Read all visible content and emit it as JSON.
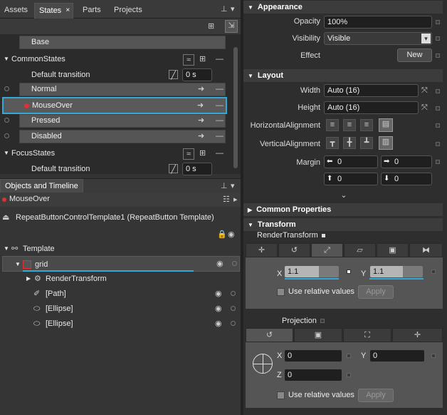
{
  "tabs": {
    "assets": "Assets",
    "states": "States",
    "close": "×",
    "parts": "Parts",
    "projects": "Projects"
  },
  "states": {
    "base": "Base",
    "group1": "CommonStates",
    "default_transition": "Default transition",
    "transition_value": "0 s",
    "normal": "Normal",
    "mouseover": "MouseOver",
    "pressed": "Pressed",
    "disabled": "Disabled",
    "group2": "FocusStates",
    "default_transition2": "Default transition",
    "transition_value2": "0 s"
  },
  "objects": {
    "title": "Objects and Timeline",
    "recording": "MouseOver",
    "template_name": "RepeatButtonControlTemplate1 (RepeatButton Template)",
    "template": "Template",
    "grid": "grid",
    "render_transform": "RenderTransform",
    "path": "[Path]",
    "ellipse1": "[Ellipse]",
    "ellipse2": "[Ellipse]"
  },
  "appearance": {
    "header": "Appearance",
    "opacity_label": "Opacity",
    "opacity_value": "100%",
    "visibility_label": "Visibility",
    "visibility_value": "Visible",
    "effect_label": "Effect",
    "new_button": "New"
  },
  "layout": {
    "header": "Layout",
    "width_label": "Width",
    "width_value": "Auto (16)",
    "height_label": "Height",
    "height_value": "Auto (16)",
    "halign_label": "HorizontalAlignment",
    "valign_label": "VerticalAlignment",
    "margin_label": "Margin",
    "m_left": "0",
    "m_right": "0",
    "m_top": "0",
    "m_bottom": "0"
  },
  "common": {
    "header": "Common Properties"
  },
  "transform": {
    "header": "Transform",
    "render_label": "RenderTransform",
    "x_label": "X",
    "x_value": "1.1",
    "y_label": "Y",
    "y_value": "1.1",
    "relative": "Use relative values",
    "apply": "Apply",
    "projection_label": "Projection",
    "px_label": "X",
    "px_value": "0",
    "py_label": "Y",
    "py_value": "0",
    "pz_label": "Z",
    "pz_value": "0",
    "relative2": "Use relative values",
    "apply2": "Apply"
  },
  "colors": {
    "accent": "#33a9d8",
    "record": "#e03030"
  }
}
